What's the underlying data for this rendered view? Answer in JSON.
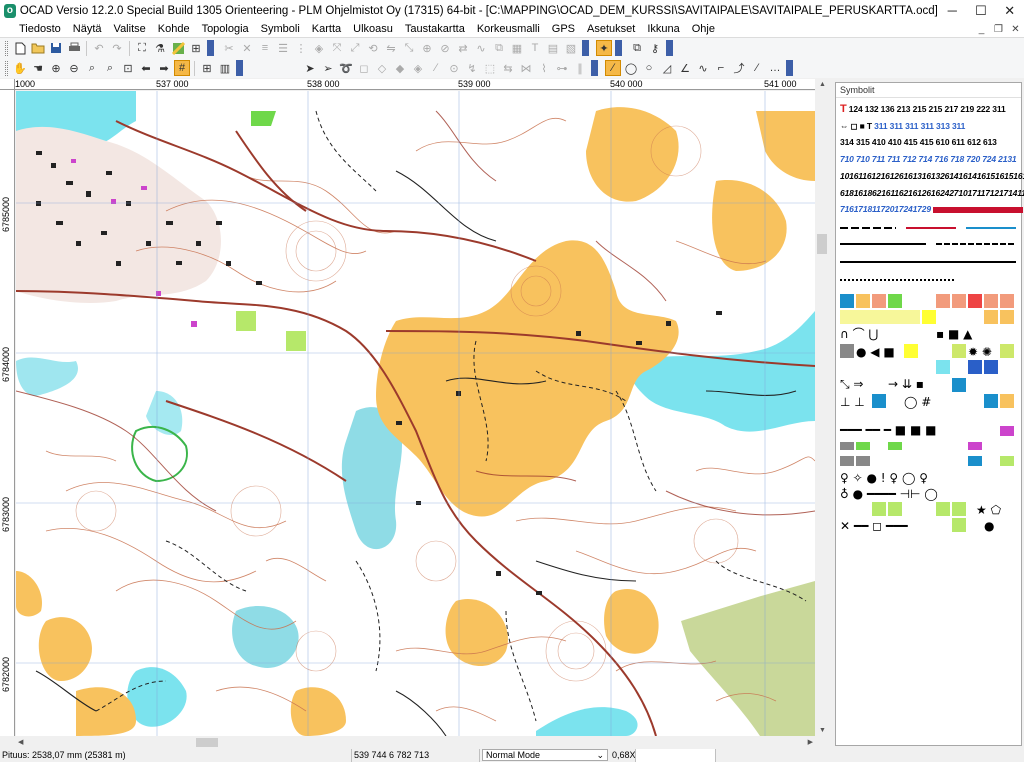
{
  "window": {
    "title": "OCAD Versio 12.2.0  Special Build 1305  Orienteering - PLM Ohjelmistot Oy (17315) 64-bit - [C:\\MAPPING\\OCAD_DEM_KURSSI\\SAVITAIPALE\\SAVITAIPALE_PERUSKARTTA.ocd]",
    "icon": "ocad-app-icon",
    "minimize": "─",
    "maximize": "☐",
    "close": "✕"
  },
  "menu": {
    "items": [
      "Tiedosto",
      "Näytä",
      "Valitse",
      "Kohde",
      "Topologia",
      "Symboli",
      "Kartta",
      "Ulkoasu",
      "Taustakartta",
      "Korkeusmalli",
      "GPS",
      "Asetukset",
      "Ikkuna",
      "Ohje"
    ],
    "mdi_minimize": "_",
    "mdi_restore": "❐",
    "mdi_close": "✕"
  },
  "rulers": {
    "x_labels": [
      "1000",
      "537 000",
      "538 000",
      "539 000",
      "540 000",
      "541 000"
    ],
    "y_labels": [
      "6785000",
      "6784000",
      "6783000",
      "6782000"
    ]
  },
  "symbols_panel": {
    "title": "Symbolit",
    "rows": [
      "124 132 136 213 215 215 217 219 222 311",
      "311 311 311 311 313 311",
      "314 315 410 410 415 415 610 611 612 613",
      "710 710 711 711 712 714 716 718 720 724 2131",
      "1016116121612616131613261416141615161516161",
      "6181618621611621612616242710171171217141142",
      "71617181172017241729"
    ]
  },
  "status": {
    "length": "Pituus: 2538,07 mm (25381 m)",
    "coords": "539 744   6 782 713",
    "mode": "Normal Mode",
    "mode_arrow": "⌄",
    "zoom": "0,68X"
  },
  "colors": {
    "forest_open": "#ffffff",
    "open_land": "#f8c25e",
    "water": "#7be3ee",
    "contour": "#c8714e",
    "road": "#9c3a2c",
    "building": "#222222",
    "marsh": "#43b8c8",
    "settlement_purple": "#cc44cc",
    "green": "#b6e86a",
    "olive": "#c9d89a"
  }
}
